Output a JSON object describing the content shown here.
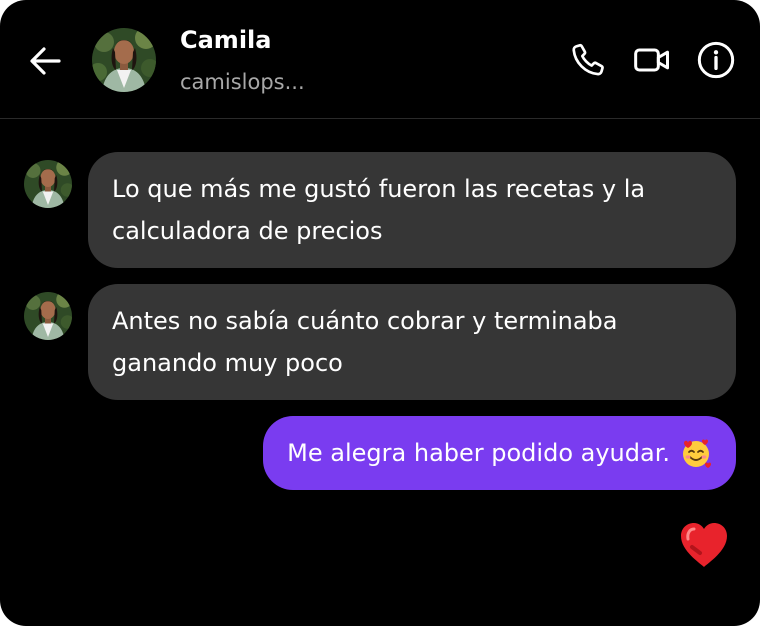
{
  "header": {
    "contact_name": "Camila",
    "contact_handle": "camislops..."
  },
  "messages": [
    {
      "direction": "incoming",
      "text": "Lo que más me gustó fueron las recetas y la calculadora de precios"
    },
    {
      "direction": "incoming",
      "text": "Antes no sabía cuánto cobrar y terminaba ganando muy poco"
    },
    {
      "direction": "outgoing",
      "text": "Me alegra haber podido ayudar.",
      "emoji": "smiling-face-with-hearts-emoji"
    }
  ],
  "reaction": "red-heart-icon",
  "colors": {
    "background": "#000000",
    "incoming_bubble": "#363636",
    "outgoing_bubble": "#7a3cf0",
    "heart": "#e8232c",
    "secondary_text": "#a8a8a8"
  }
}
